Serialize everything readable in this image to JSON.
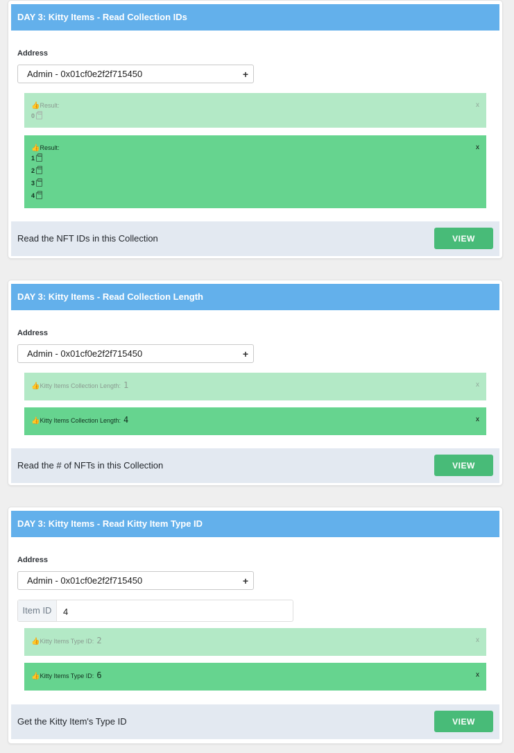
{
  "cards": [
    {
      "title": "DAY 3: Kitty Items - Read Collection IDs",
      "address_label": "Address",
      "address_value": "Admin - 0x01cf0e2f2f715450",
      "results": [
        {
          "label": "Result:",
          "ids": [
            "0"
          ],
          "close": "x"
        },
        {
          "label": "Result:",
          "ids": [
            "1",
            "2",
            "3",
            "4"
          ],
          "close": "x"
        }
      ],
      "footer_text": "Read the NFT IDs in this Collection",
      "view_label": "VIEW"
    },
    {
      "title": "DAY 3: Kitty Items - Read Collection Length",
      "address_label": "Address",
      "address_value": "Admin - 0x01cf0e2f2f715450",
      "results": [
        {
          "label": "Kitty Items Collection Length:",
          "value": "1",
          "close": "x"
        },
        {
          "label": "Kitty Items Collection Length:",
          "value": "4",
          "close": "x"
        }
      ],
      "footer_text": "Read the # of NFTs in this Collection",
      "view_label": "VIEW"
    },
    {
      "title": "DAY 3: Kitty Items - Read Kitty Item Type ID",
      "address_label": "Address",
      "address_value": "Admin - 0x01cf0e2f2f715450",
      "item_id_label": "Item ID",
      "item_id_value": "4",
      "results": [
        {
          "label": "Kitty Items Type ID:",
          "value": "2",
          "close": "x"
        },
        {
          "label": "Kitty Items Type ID:",
          "value": "6",
          "close": "x"
        }
      ],
      "footer_text": "Get the Kitty Item's Type ID",
      "view_label": "VIEW"
    }
  ],
  "icons": {
    "thumbs_up": "👍",
    "clipboard": "clipboard-icon",
    "plus": "+"
  },
  "colors": {
    "header": "#63b0eb",
    "result_faded": "#b3e9c6",
    "result_active": "#66d48f",
    "footer": "#e3e9f1",
    "button": "#48bb78"
  }
}
